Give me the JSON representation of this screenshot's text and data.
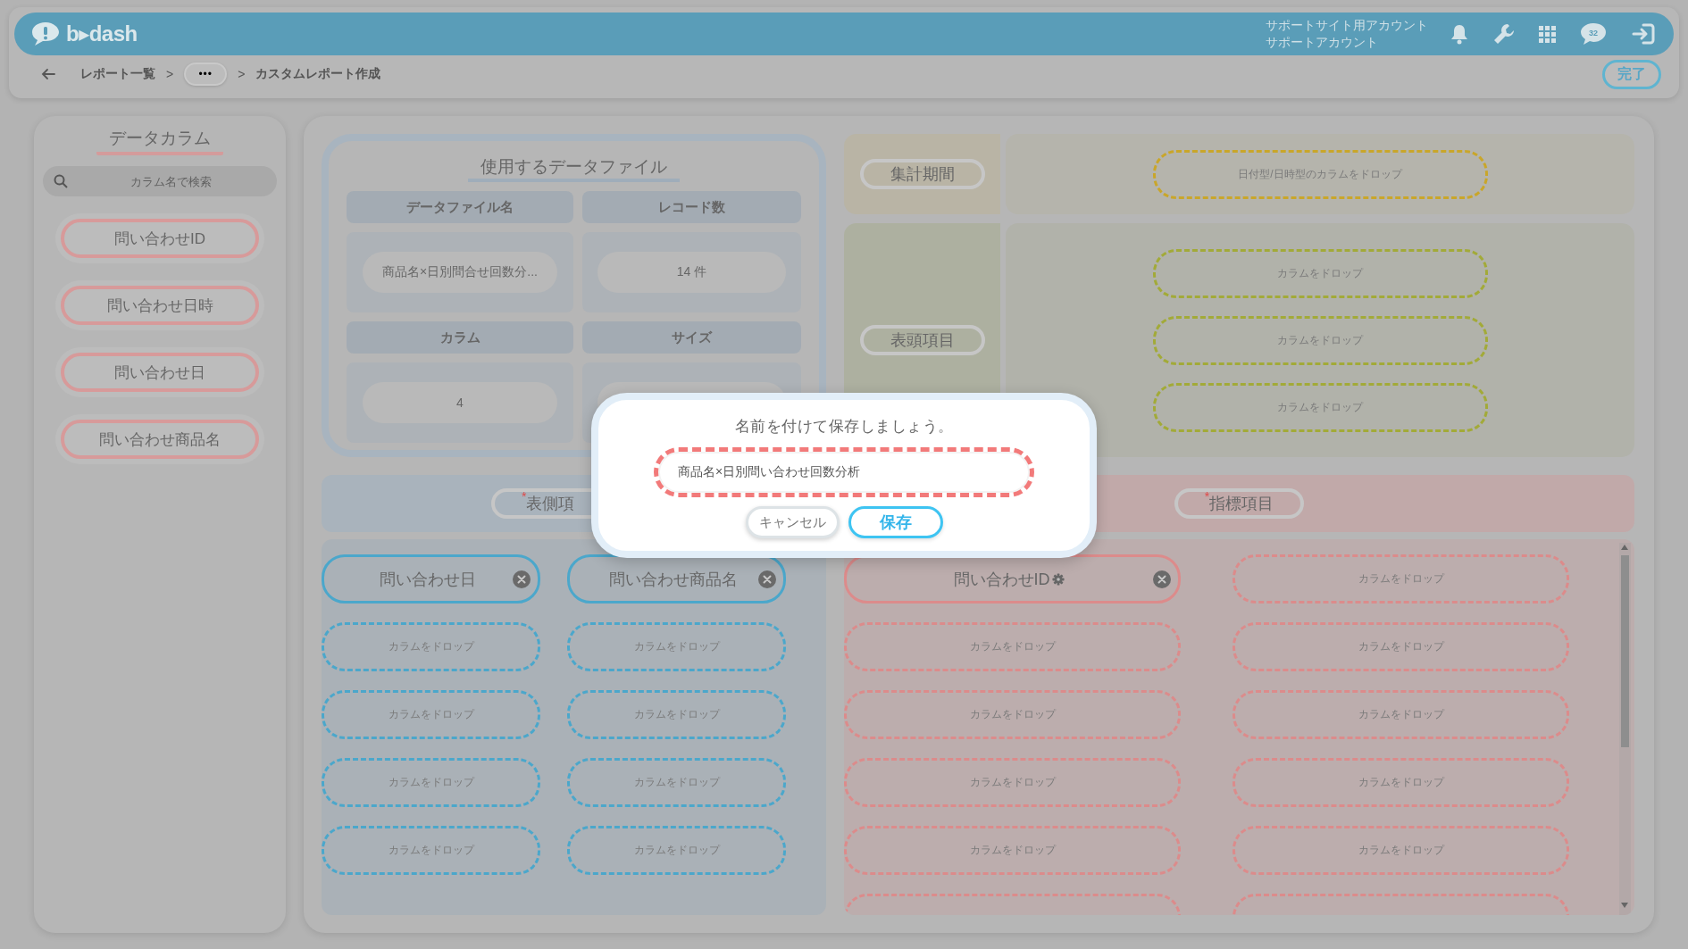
{
  "header": {
    "logo": "b▸dash",
    "account_lines": [
      "サポートサイト用アカウント",
      "サポートアカウント"
    ],
    "chat_count": "32"
  },
  "breadcrumb": [
    {
      "kind": "link",
      "text": "レポート一覧"
    },
    {
      "kind": "sep",
      "text": ">"
    },
    {
      "kind": "more",
      "text": "•••"
    },
    {
      "kind": "sep",
      "text": ">"
    },
    {
      "kind": "current",
      "text": "カスタムレポート作成"
    }
  ],
  "done_button": "完了",
  "sidebar": {
    "title": "データカラム",
    "search_placeholder": "カラム名で検索",
    "columns": [
      "問い合わせID",
      "問い合わせ日時",
      "問い合わせ日",
      "問い合わせ商品名"
    ]
  },
  "data_file": {
    "title": "使用するデータファイル",
    "cells": [
      {
        "kind": "header",
        "text": "データファイル名"
      },
      {
        "kind": "header",
        "text": "レコード数"
      },
      {
        "kind": "value",
        "text": "商品名×日別問合せ回数分..."
      },
      {
        "kind": "value",
        "text": "14 件"
      },
      {
        "kind": "header",
        "text": "カラム"
      },
      {
        "kind": "header",
        "text": "サイズ"
      },
      {
        "kind": "value",
        "text": "4"
      },
      {
        "kind": "value"
      }
    ]
  },
  "period": {
    "label": "集計期間",
    "drops": [
      "日付型/日時型のカラムをドロップ"
    ]
  },
  "column_header": {
    "label": "表頭項目",
    "drops": [
      "カラムをドロップ",
      "カラムをドロップ",
      "カラムをドロップ"
    ]
  },
  "row_header": {
    "mark": "*",
    "label": "表側項",
    "slots": [
      {
        "kind": "column",
        "label": "問い合わせ日",
        "settings": false
      },
      {
        "kind": "column",
        "label": "問い合わせ商品名",
        "settings": false
      },
      {
        "kind": "drop",
        "label": "カラムをドロップ"
      },
      {
        "kind": "drop",
        "label": "カラムをドロップ"
      },
      {
        "kind": "drop",
        "label": "カラムをドロップ"
      },
      {
        "kind": "drop",
        "label": "カラムをドロップ"
      },
      {
        "kind": "drop",
        "label": "カラムをドロップ"
      },
      {
        "kind": "drop",
        "label": "カラムをドロップ"
      },
      {
        "kind": "drop",
        "label": "カラムをドロップ"
      },
      {
        "kind": "drop",
        "label": "カラムをドロップ"
      }
    ]
  },
  "indicators": {
    "mark": "*",
    "label": "指標項目",
    "slots": [
      {
        "kind": "column",
        "label": "問い合わせID",
        "settings": true
      },
      {
        "kind": "drop",
        "label": "カラムをドロップ"
      },
      {
        "kind": "drop",
        "label": "カラムをドロップ"
      },
      {
        "kind": "drop",
        "label": "カラムをドロップ"
      },
      {
        "kind": "drop",
        "label": "カラムをドロップ"
      },
      {
        "kind": "drop",
        "label": "カラムをドロップ"
      },
      {
        "kind": "drop",
        "label": "カラムをドロップ"
      },
      {
        "kind": "drop",
        "label": "カラムをドロップ"
      },
      {
        "kind": "drop",
        "label": "カラムをドロップ"
      },
      {
        "kind": "drop",
        "label": "カラムをドロップ"
      },
      {
        "kind": "drop"
      },
      {
        "kind": "drop"
      }
    ]
  },
  "dialog": {
    "title": "名前を付けて保存しましょう。",
    "name_value": "商品名×日別問い合わせ回数分析",
    "buttons": [
      {
        "kind": "cancel",
        "label": "キャンセル"
      },
      {
        "kind": "primary",
        "label": "保存"
      }
    ]
  }
}
